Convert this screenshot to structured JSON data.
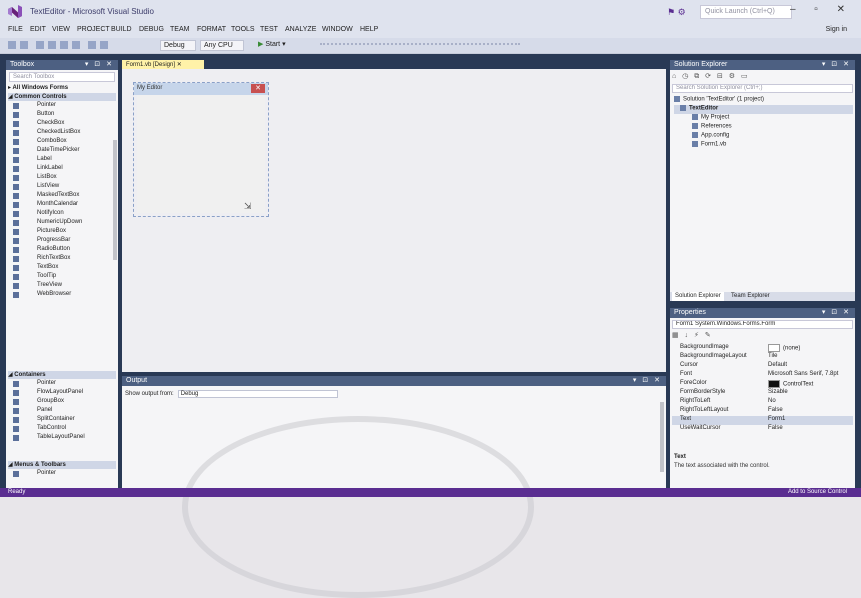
{
  "window": {
    "title": "TextEditor - Microsoft Visual Studio",
    "quick_launch_placeholder": "Quick Launch (Ctrl+Q)",
    "window_controls": "– ▫ ✕"
  },
  "menu": {
    "items": [
      "FILE",
      "EDIT",
      "VIEW",
      "PROJECT",
      "BUILD",
      "DEBUG",
      "TEAM",
      "FORMAT",
      "TOOLS",
      "TEST",
      "ANALYZE",
      "WINDOW",
      "HELP"
    ],
    "sign_in": "Sign in"
  },
  "toolbar": {
    "configuration": "Debug",
    "platform": "Any CPU",
    "start_label": "Start"
  },
  "toolbox": {
    "header": "Toolbox",
    "search_placeholder": "Search Toolbox",
    "groups": {
      "all_forms": "▸ All Windows Forms",
      "common": "◢ Common Controls",
      "containers": "◢ Containers",
      "menus": "◢ Menus & Toolbars"
    },
    "common_controls": [
      "Pointer",
      "Button",
      "CheckBox",
      "CheckedListBox",
      "ComboBox",
      "DateTimePicker",
      "Label",
      "LinkLabel",
      "ListBox",
      "ListView",
      "MaskedTextBox",
      "MonthCalendar",
      "NotifyIcon",
      "NumericUpDown",
      "PictureBox",
      "ProgressBar",
      "RadioButton",
      "RichTextBox",
      "TextBox",
      "ToolTip",
      "TreeView",
      "WebBrowser"
    ],
    "containers": [
      "Pointer",
      "FlowLayoutPanel",
      "GroupBox",
      "Panel",
      "SplitContainer",
      "TabControl",
      "TableLayoutPanel"
    ],
    "menus": [
      "Pointer"
    ]
  },
  "document": {
    "tab_label": "Form1.vb [Design]",
    "form_title": "My Editor"
  },
  "output": {
    "header": "Output",
    "show_output_label": "Show output from:",
    "show_output_value": "Debug"
  },
  "solution_explorer": {
    "header": "Solution Explorer",
    "toolbar_icons": "⌂ ◷ ⧉ ⟳ ⊟ ⚙ ▭",
    "search_placeholder": "Search Solution Explorer (Ctrl+;)",
    "tree": [
      {
        "label": "Solution 'TextEditor' (1 project)",
        "indent": 0
      },
      {
        "label": "TextEditor",
        "indent": 1,
        "selected": true
      },
      {
        "label": "My Project",
        "indent": 2
      },
      {
        "label": "References",
        "indent": 2
      },
      {
        "label": "App.config",
        "indent": 2
      },
      {
        "label": "Form1.vb",
        "indent": 2
      }
    ],
    "tabs": [
      "Solution Explorer",
      "Team Explorer"
    ]
  },
  "properties": {
    "header": "Properties",
    "object_selector": "Form1 System.Windows.Forms.Form",
    "toolbar_icons": "▦ ↓ ⚡ ✎",
    "rows": [
      {
        "name": "BackgroundImage",
        "value": "(none)",
        "swatch": "#ffffff"
      },
      {
        "name": "BackgroundImageLayout",
        "value": "Tile"
      },
      {
        "name": "Cursor",
        "value": "Default"
      },
      {
        "name": "Font",
        "value": "Microsoft Sans Serif, 7.8pt"
      },
      {
        "name": "ForeColor",
        "value": "ControlText",
        "swatch": "#111111"
      },
      {
        "name": "FormBorderStyle",
        "value": "Sizable"
      },
      {
        "name": "RightToLeft",
        "value": "No"
      },
      {
        "name": "RightToLeftLayout",
        "value": "False"
      },
      {
        "name": "Text",
        "value": "Form1",
        "selected": true
      },
      {
        "name": "UseWaitCursor",
        "value": "False"
      }
    ],
    "description_title": "Text",
    "description": "The text associated with the control."
  },
  "status": {
    "left": "Ready",
    "right": "Add to Source Control"
  }
}
